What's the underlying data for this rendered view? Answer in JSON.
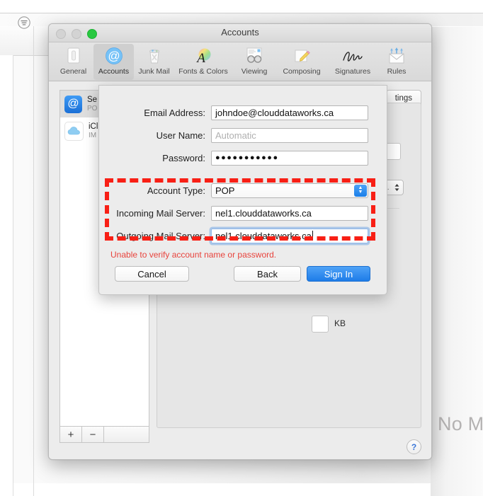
{
  "background": {
    "filter_icon": "filter-icon",
    "no_messages_text": "No M"
  },
  "prefs_window": {
    "title": "Accounts",
    "traffic_lights": [
      "close",
      "minimize",
      "zoom"
    ],
    "toolbar": [
      {
        "label": "General",
        "icon": "general-icon"
      },
      {
        "label": "Accounts",
        "icon": "accounts-at-icon",
        "selected": true
      },
      {
        "label": "Junk Mail",
        "icon": "junk-mail-trash-icon"
      },
      {
        "label": "Fonts & Colors",
        "icon": "fonts-colors-icon"
      },
      {
        "label": "Viewing",
        "icon": "viewing-glasses-icon"
      },
      {
        "label": "Composing",
        "icon": "composing-pencil-icon"
      },
      {
        "label": "Signatures",
        "icon": "signatures-icon"
      },
      {
        "label": "Rules",
        "icon": "rules-envelope-icon"
      }
    ],
    "accounts": [
      {
        "name": "Se",
        "kind": "PO",
        "icon": "mail-at-icon",
        "selected": true
      },
      {
        "name": "iCl",
        "kind": "IM",
        "icon": "icloud-cloud-icon",
        "selected": false
      }
    ],
    "list_footer": {
      "add": "+",
      "remove": "−"
    },
    "tab_partial": "tings",
    "ghost_unit_label": "KB",
    "help_button": "?"
  },
  "sheet": {
    "fields": [
      {
        "label": "Email Address:",
        "value": "johndoe@clouddataworks.ca",
        "type": "text",
        "state": "normal"
      },
      {
        "label": "User Name:",
        "value": "Automatic",
        "type": "text",
        "state": "placeholder"
      },
      {
        "label": "Password:",
        "value": "●●●●●●●●●●●",
        "type": "password",
        "state": "normal"
      },
      {
        "label": "Account Type:",
        "value": "POP",
        "type": "popup",
        "state": "normal"
      },
      {
        "label": "Incoming Mail Server:",
        "value": "nel1.clouddataworks.ca",
        "type": "text",
        "state": "normal"
      },
      {
        "label": "Outgoing Mail Server:",
        "value": "nel1.clouddataworks.ca",
        "type": "text",
        "state": "focused"
      }
    ],
    "error_message": "Unable to verify account name or password.",
    "buttons": {
      "cancel": "Cancel",
      "back": "Back",
      "signin": "Sign In"
    }
  },
  "annotation": {
    "color": "#f81f15",
    "style": "dashed-rectangle"
  }
}
